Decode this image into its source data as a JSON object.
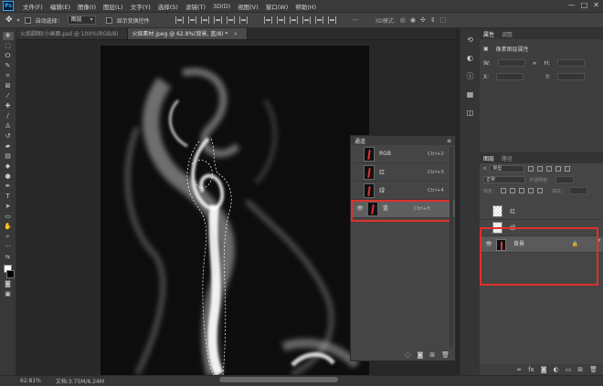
{
  "app": {
    "logo_text": "Ps"
  },
  "menu": [
    "文件(F)",
    "编辑(E)",
    "图像(I)",
    "图层(L)",
    "文字(Y)",
    "选择(S)",
    "滤镜(T)",
    "3D(D)",
    "视图(V)",
    "窗口(W)",
    "帮助(H)"
  ],
  "window_controls": [
    "—",
    "□",
    "✕"
  ],
  "options": {
    "auto_select_label": "自动选择：",
    "auto_select_value": "图层",
    "transform_label": "显示变换控件"
  },
  "tabs": [
    {
      "label": "火焰脚图(小画面.psd @ 100%(RGB/8)"
    },
    {
      "label": "火焰素材.jpeg @ 62.8%(背景, 蓝/8) *",
      "close": "×"
    }
  ],
  "channels_panel": {
    "title": "通道",
    "menu_icon": "≡",
    "rows": [
      {
        "name": "RGB",
        "key": "Ctrl+2",
        "visible": false
      },
      {
        "name": "红",
        "key": "Ctrl+3",
        "visible": false
      },
      {
        "name": "绿",
        "key": "Ctrl+4",
        "visible": false
      },
      {
        "name": "蓝",
        "key": "Ctrl+5",
        "visible": true
      }
    ],
    "eye_glyph": "👁"
  },
  "properties_panel": {
    "tab1": "属性",
    "tab2": "调整",
    "section": "像素图层属性",
    "w_label": "W:",
    "h_label": "H:",
    "x_label": "X:",
    "y_label": "Y:"
  },
  "layers_panel": {
    "tab1": "图层",
    "tab2": "路径",
    "kind_label": "类型",
    "blend_label": "正常",
    "opacity_label": "不透明度：",
    "lock_label": "锁定：",
    "fill_label": "填充：",
    "rows": [
      {
        "name": "红",
        "visible": false,
        "lock": ""
      },
      {
        "name": "绿",
        "visible": false,
        "lock": ""
      },
      {
        "name": "背景",
        "visible": true,
        "lock": "🔒"
      }
    ]
  },
  "status": {
    "zoom": "62.81%",
    "doc": "文档:3.75M/6.24M"
  }
}
